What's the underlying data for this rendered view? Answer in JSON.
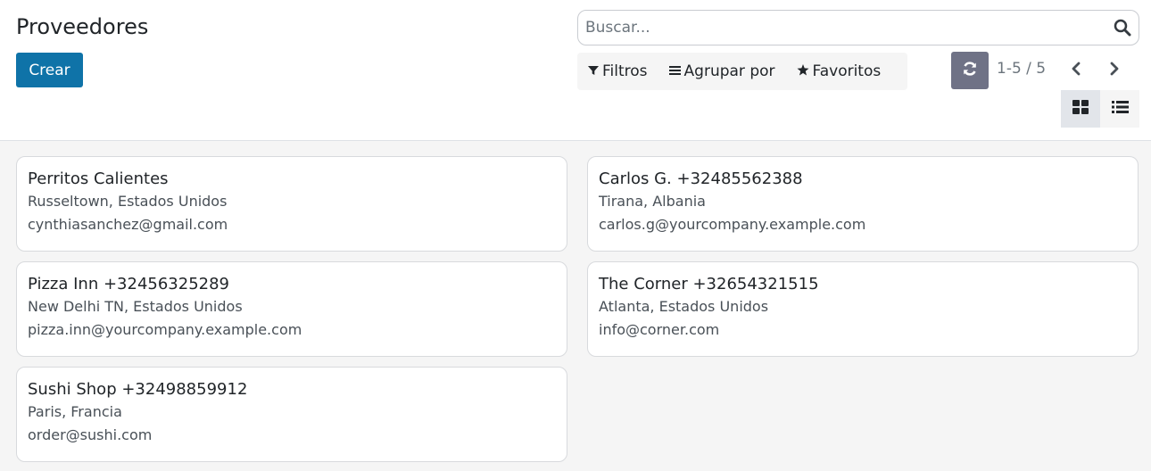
{
  "header": {
    "title": "Proveedores",
    "create_label": "Crear"
  },
  "search": {
    "placeholder": "Buscar..."
  },
  "filters": {
    "filters_label": "Filtros",
    "group_by_label": "Agrupar por",
    "favorites_label": "Favoritos"
  },
  "pager": {
    "value": "1-5 / 5"
  },
  "colors": {
    "primary": "#0f73a8",
    "reload_button": "#6f7286"
  },
  "cards": [
    {
      "name": "Perritos Calientes",
      "location": "Russeltown, Estados Unidos",
      "email": "cynthiasanchez@gmail.com"
    },
    {
      "name": "Carlos G. +32485562388",
      "location": "Tirana, Albania",
      "email": "carlos.g@yourcompany.example.com"
    },
    {
      "name": "Pizza Inn +32456325289",
      "location": "New Delhi TN, Estados Unidos",
      "email": "pizza.inn@yourcompany.example.com"
    },
    {
      "name": "The Corner +32654321515",
      "location": "Atlanta, Estados Unidos",
      "email": "info@corner.com"
    },
    {
      "name": "Sushi Shop +32498859912",
      "location": "Paris, Francia",
      "email": "order@sushi.com"
    }
  ]
}
